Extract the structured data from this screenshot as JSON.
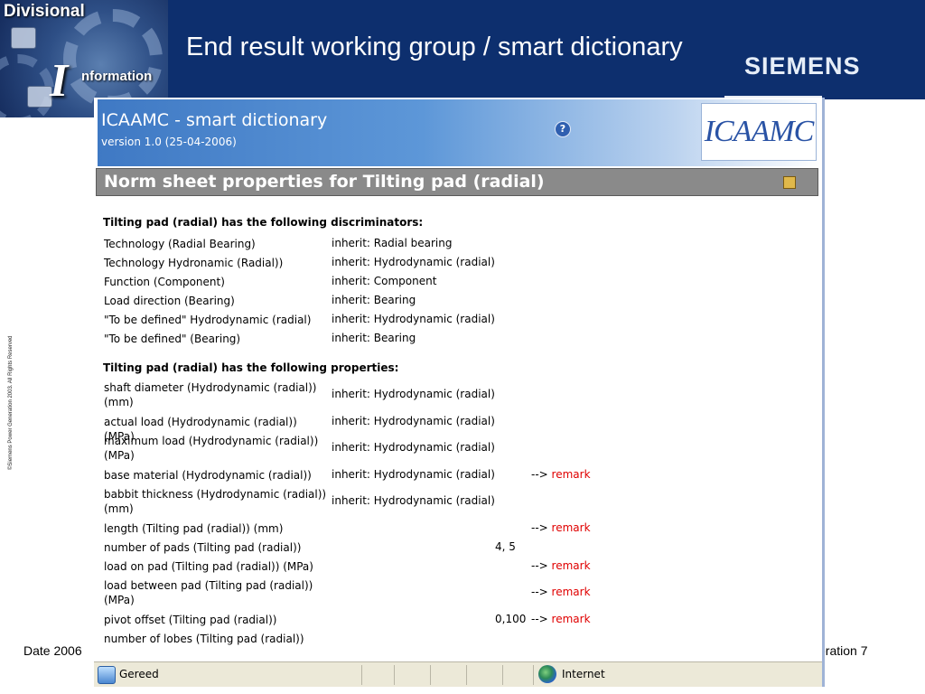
{
  "slide": {
    "title": "End result working group / smart dictionary",
    "brand": "SIEMENS",
    "logo": {
      "word1": "Divisional",
      "word2": "nformation",
      "big_letter": "I"
    },
    "copyright": "©Siemens Power Generation 2003. All Rights Reserved",
    "footer_date": "Date 2006",
    "footer_right": "eration",
    "page_number": "7"
  },
  "app": {
    "title_main": "ICAAMC",
    "title_rest": " - smart dictionary",
    "version": "version 1.0 (25-04-2006)",
    "logo_text": "ICAAMC",
    "help_icon": "help-icon"
  },
  "section": {
    "title": "Norm sheet properties for Tilting pad (radial)"
  },
  "discriminators": {
    "heading": "Tilting pad (radial) has the following discriminators:",
    "rows": [
      {
        "name": "Technology (Radial Bearing)",
        "value": "inherit: Radial bearing"
      },
      {
        "name": "Technology Hydronamic (Radial))",
        "value": "inherit: Hydrodynamic (radial)"
      },
      {
        "name": "Function (Component)",
        "value": "inherit: Component"
      },
      {
        "name": "Load direction (Bearing)",
        "value": "inherit: Bearing"
      },
      {
        "name": "\"To be defined\" Hydrodynamic (radial)",
        "value": "inherit: Hydrodynamic (radial)"
      },
      {
        "name": "\"To be defined\" (Bearing)",
        "value": "inherit: Bearing"
      }
    ]
  },
  "properties": {
    "heading": "Tilting pad (radial) has the following properties:",
    "arrow": "-->",
    "remark_label": "remark",
    "rows": [
      {
        "name": "shaft diameter (Hydrodynamic (radial)) (mm)",
        "value": "inherit: Hydrodynamic (radial)",
        "extra": "",
        "remark": false
      },
      {
        "name": "actual load (Hydrodynamic (radial)) (MPa)",
        "value": "inherit: Hydrodynamic (radial)",
        "extra": "",
        "remark": false
      },
      {
        "name": "maximum load (Hydrodynamic (radial)) (MPa)",
        "value": "inherit: Hydrodynamic (radial)",
        "extra": "",
        "remark": false
      },
      {
        "name": "base material (Hydrodynamic (radial))",
        "value": "inherit: Hydrodynamic (radial)",
        "extra": "",
        "remark": true
      },
      {
        "name": "babbit thickness (Hydrodynamic (radial)) (mm)",
        "value": "inherit: Hydrodynamic (radial)",
        "extra": "",
        "remark": false
      },
      {
        "name": "length (Tilting pad (radial)) (mm)",
        "value": "",
        "extra": "",
        "remark": true
      },
      {
        "name": "number of pads (Tilting pad (radial))",
        "value": "",
        "extra": "4, 5",
        "remark": false
      },
      {
        "name": "load on pad (Tilting pad (radial)) (MPa)",
        "value": "",
        "extra": "",
        "remark": true
      },
      {
        "name": "load between pad (Tilting pad (radial)) (MPa)",
        "value": "",
        "extra": "",
        "remark": true
      },
      {
        "name": "pivot offset (Tilting pad (radial))",
        "value": "",
        "extra": "0,100",
        "remark": true
      },
      {
        "name": "number of lobes (Tilting pad (radial))",
        "value": "",
        "extra": "",
        "remark": false
      }
    ]
  },
  "statusbar": {
    "status": "Gereed",
    "zone": "Internet"
  }
}
